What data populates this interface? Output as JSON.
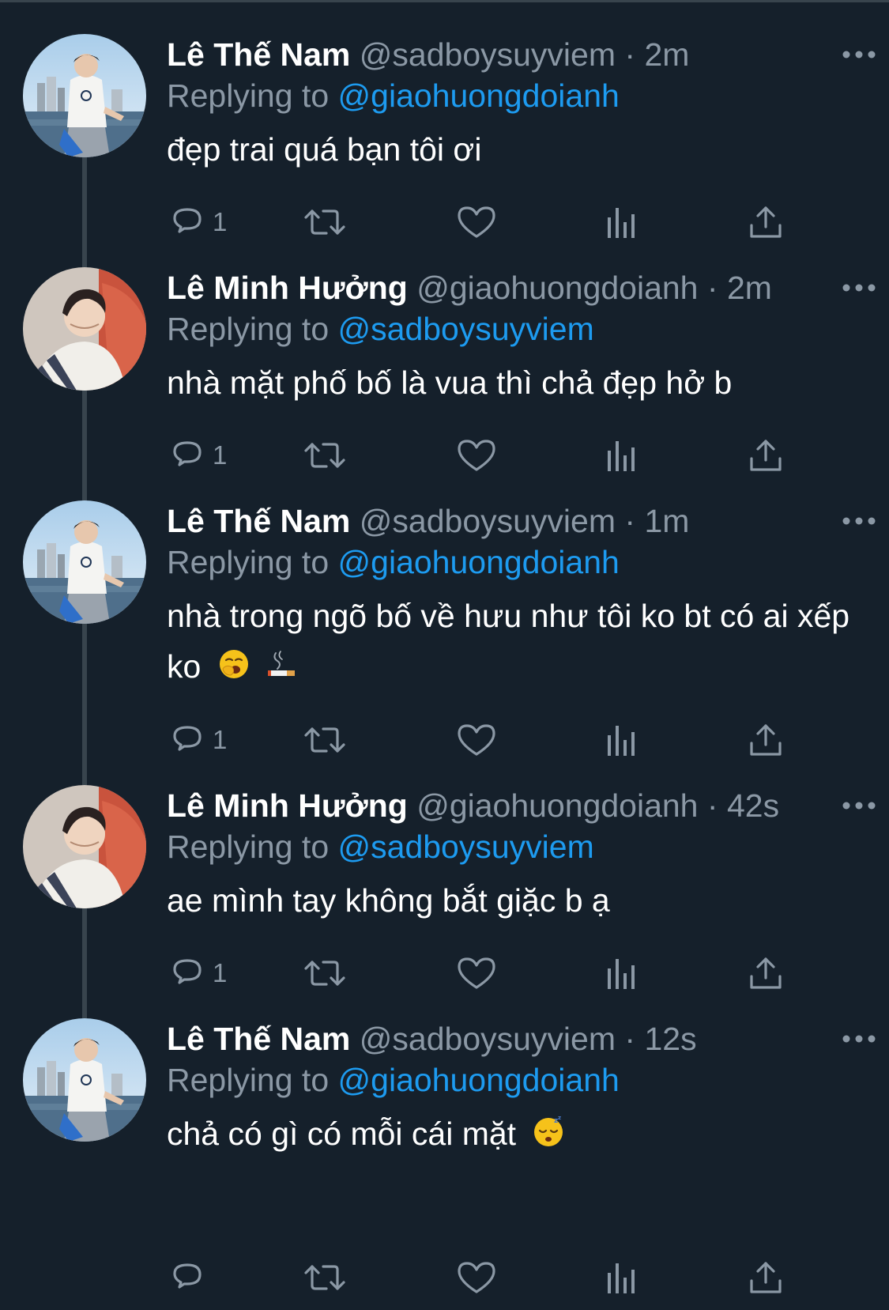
{
  "colors": {
    "background": "#15202b",
    "text_primary": "#ffffff",
    "text_secondary": "#8b98a5",
    "mention": "#1d9bf0",
    "thread_line": "#38444d"
  },
  "labels": {
    "replying_to": "Replying to",
    "separator": "·"
  },
  "tweets": [
    {
      "display_name": "Lê Thế Nam",
      "handle": "@sadboysuyviem",
      "time": "2m",
      "reply_to": "@giaohuongdoianh",
      "text": "đẹp trai quá bạn tôi ơi",
      "reply_count": "1",
      "avatar": "nam-avatar",
      "emojis": []
    },
    {
      "display_name": "Lê Minh Hưởng",
      "handle": "@giaohuongdoianh",
      "time": "2m",
      "reply_to": "@sadboysuyviem",
      "text": "nhà mặt phố bố là vua thì chả đẹp hở b",
      "reply_count": "1",
      "avatar": "huong-avatar",
      "emojis": []
    },
    {
      "display_name": "Lê Thế Nam",
      "handle": "@sadboysuyviem",
      "time": "1m",
      "reply_to": "@giaohuongdoianh",
      "text": "nhà trong ngõ bố về hưu như tôi ko bt có ai xếp ko",
      "reply_count": "1",
      "avatar": "nam-avatar",
      "emojis": [
        "yawning-face-emoji",
        "cigarette-emoji"
      ]
    },
    {
      "display_name": "Lê Minh Hưởng",
      "handle": "@giaohuongdoianh",
      "time": "42s",
      "reply_to": "@sadboysuyviem",
      "text": "ae mình tay không bắt giặc b ạ",
      "reply_count": "1",
      "avatar": "huong-avatar",
      "emojis": []
    },
    {
      "display_name": "Lê Thế Nam",
      "handle": "@sadboysuyviem",
      "time": "12s",
      "reply_to": "@giaohuongdoianh",
      "text": "chả có gì có mỗi cái mặt",
      "reply_count": "",
      "avatar": "nam-avatar",
      "emojis": [
        "sleeping-face-emoji"
      ]
    }
  ],
  "action_icons": [
    "reply-icon",
    "retweet-icon",
    "like-icon",
    "views-icon",
    "share-icon"
  ]
}
